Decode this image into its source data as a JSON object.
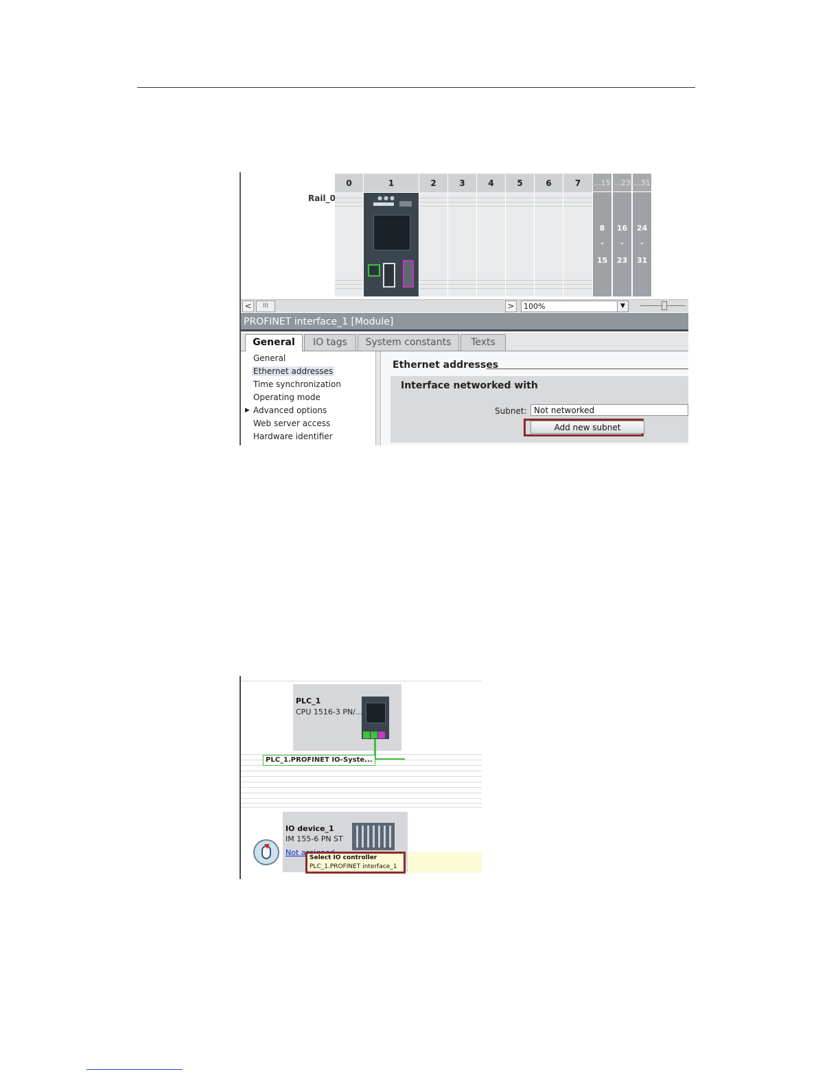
{
  "screenshot1": {
    "rail_label": "Rail_0",
    "slots": [
      "0",
      "1",
      "2",
      "3",
      "4",
      "5",
      "6",
      "7"
    ],
    "extra_slots": [
      {
        "head": "...15",
        "from": "8",
        "dash": "-",
        "to": "15"
      },
      {
        "head": "...23",
        "from": "16",
        "dash": "-",
        "to": "23"
      },
      {
        "head": "...31",
        "from": "24",
        "dash": "-",
        "to": "31"
      }
    ],
    "scroll_left": "<",
    "scroll_right": ">",
    "scroll_thumb": "III",
    "zoom_value": "100%",
    "zoom_dropdown": "▼",
    "module_title": "PROFINET interface_1 [Module]",
    "tabs": [
      "General",
      "IO tags",
      "System constants",
      "Texts"
    ],
    "nav": [
      "General",
      "Ethernet addresses",
      "Time synchronization",
      "Operating mode",
      "Advanced options",
      "Web server access",
      "Hardware identifier"
    ],
    "nav_expand": "▶",
    "section_title": "Ethernet addresses",
    "group_title": "Interface networked with",
    "subnet_label": "Subnet:",
    "subnet_value": "Not networked",
    "add_subnet_button": "Add new subnet"
  },
  "screenshot2": {
    "plc_name": "PLC_1",
    "plc_type": "CPU 1516-3 PN/...",
    "io_system_label": "PLC_1.PROFINET IO-Syste...",
    "io_device_name": "IO device_1",
    "io_device_type": "IM 155-6 PN ST",
    "not_assigned": "Not assigned",
    "popup_title": "Select IO controller",
    "popup_item": "PLC_1.PROFINET interface_1"
  }
}
